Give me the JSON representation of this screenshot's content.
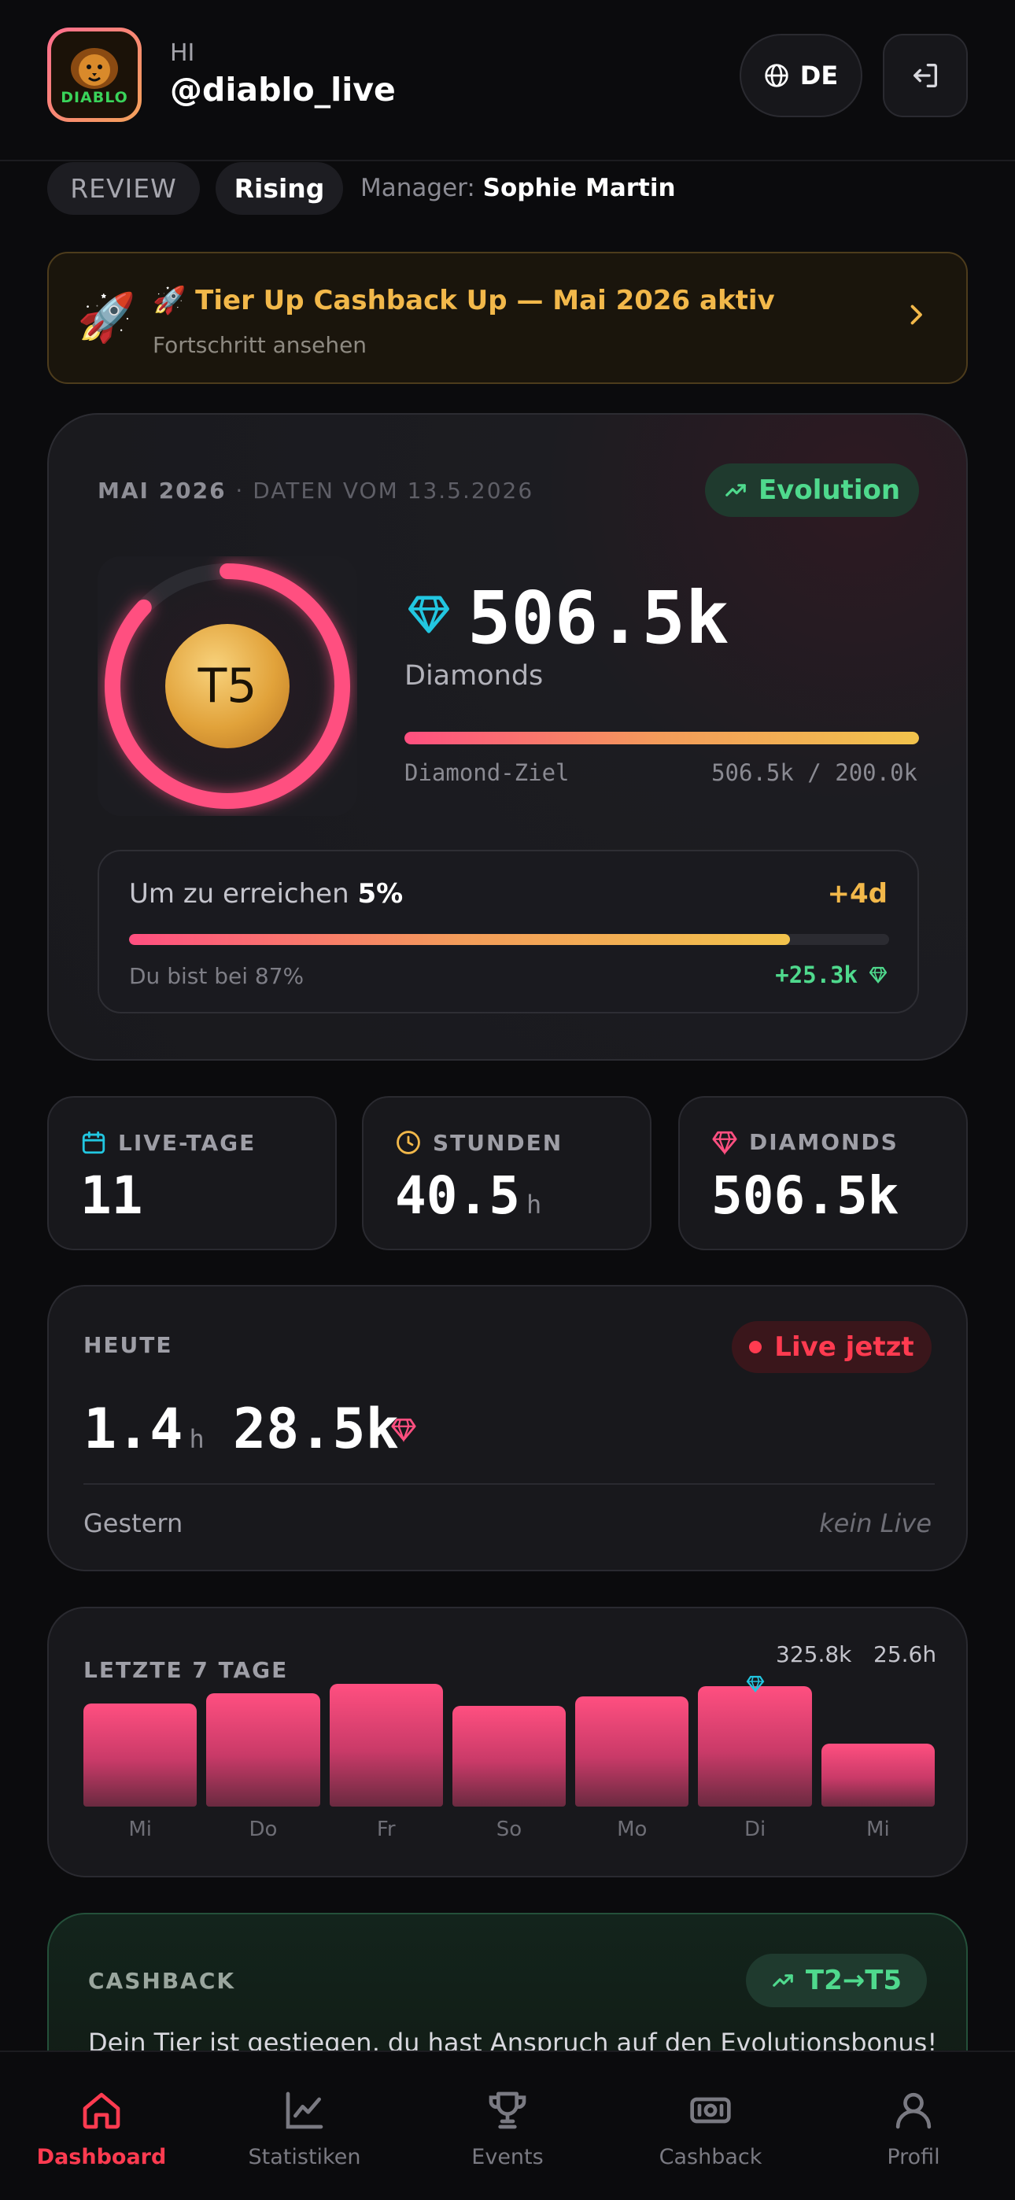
{
  "header": {
    "avatar_text": "DIABLO",
    "greeting": "HI",
    "username": "@diablo_live",
    "language": "DE"
  },
  "chips": {
    "review": "REVIEW",
    "rising": "Rising",
    "manager_label": "Manager:",
    "manager_name": "Sophie Martin"
  },
  "banner": {
    "icon": "rocket-icon",
    "title": "🚀 Tier Up Cashback Up — Mai 2026 aktiv",
    "subtitle": "Fortschritt ansehen"
  },
  "summary": {
    "period": "MAI 2026",
    "data_date": "· DATEN VOM 13.5.2026",
    "evolution_label": "Evolution",
    "tier": "T5",
    "tier_progress": 0.87,
    "diamonds_value": "506.5k",
    "diamonds_label": "Diamonds",
    "goal_label": "Diamond-Ziel",
    "goal_value": "506.5k / 200.0k",
    "goal_progress": 1.0,
    "reach_prefix": "Um zu erreichen",
    "reach_percent": "5%",
    "days_delta": "+4d",
    "reach_progress": 0.87,
    "at_percent": "Du bist bei 87%",
    "diamonds_needed": "+25.3k"
  },
  "stats": [
    {
      "label": "LIVE-TAGE",
      "value": "11",
      "unit": "",
      "icon": "calendar-icon"
    },
    {
      "label": "STUNDEN",
      "value": "40.5",
      "unit": "h",
      "icon": "clock-icon"
    },
    {
      "label": "DIAMONDS",
      "value": "506.5k",
      "unit": "",
      "icon": "diamond-icon"
    }
  ],
  "today": {
    "title": "HEUTE",
    "live_label": "Live jetzt",
    "hours": "1.4",
    "hours_unit": "h",
    "diamonds": "28.5k",
    "yesterday_label": "Gestern",
    "yesterday_value": "kein Live"
  },
  "week": {
    "title": "LETZTE 7 TAGE",
    "peak_value": "325.8k",
    "peak_hours": "25.6h",
    "days": [
      "Mi",
      "Do",
      "Fr",
      "So",
      "Mo",
      "Di",
      "Mi"
    ],
    "values": [
      0.84,
      0.92,
      1.0,
      0.82,
      0.9,
      0.98,
      0.51
    ],
    "peak_index": 5
  },
  "cashback": {
    "title": "CASHBACK",
    "tier_change": "T2→T5",
    "text": "Dein Tier ist gestiegen, du hast Anspruch auf den Evolutionsbonus!"
  },
  "nav": [
    {
      "label": "Dashboard",
      "icon": "home-icon",
      "active": true
    },
    {
      "label": "Statistiken",
      "icon": "chart-icon",
      "active": false
    },
    {
      "label": "Events",
      "icon": "trophy-icon",
      "active": false
    },
    {
      "label": "Cashback",
      "icon": "cash-icon",
      "active": false
    },
    {
      "label": "Profil",
      "icon": "user-icon",
      "active": false
    }
  ],
  "colors": {
    "accent": "#ff3b50",
    "pink": "#ff4f80",
    "gold": "#f2b84a",
    "green": "#4fd98d",
    "cyan": "#22c6e0"
  }
}
